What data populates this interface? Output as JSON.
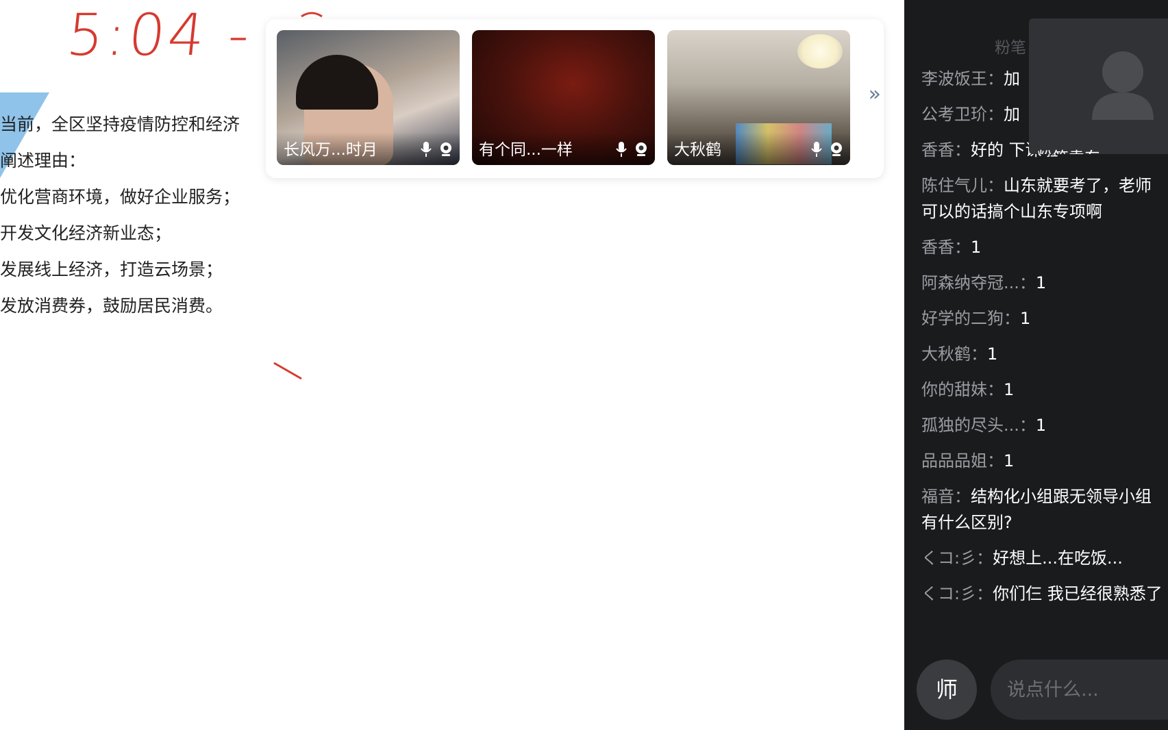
{
  "whiteboard": {
    "handwritten_time": "5:04 -",
    "lines": [
      "当前，全区坚持疫情防控和经济",
      "阐述理由：",
      "优化营商环境，做好企业服务；",
      "开发文化经济新业态；",
      "发展线上经济，打造云场景；",
      "发放消费券，鼓励居民消费。"
    ]
  },
  "video_strip": {
    "tiles": [
      {
        "name": "长风万...时月"
      },
      {
        "name": "有个同...一样"
      },
      {
        "name": "大秋鹤"
      }
    ],
    "more_icon": "double-chevron-right-icon",
    "more_label": "»"
  },
  "chat": {
    "header_faint": "粉笔",
    "host": {
      "name": "粉笔袁东",
      "icon": "user-avatar-icon"
    },
    "messages": [
      {
        "nick": "李波饭王：",
        "text": "加"
      },
      {
        "nick": "公考卫玠：",
        "text": "加"
      },
      {
        "nick": "香香：",
        "text": "好的 下课啦"
      },
      {
        "nick": "陈住气儿：",
        "text": "山东就要考了，老师可以的话搞个山东专项啊"
      },
      {
        "nick": "香香：",
        "text": "1"
      },
      {
        "nick": "阿森纳夺冠...：",
        "text": "1"
      },
      {
        "nick": "好学的二狗：",
        "text": "1"
      },
      {
        "nick": "大秋鹤：",
        "text": "1"
      },
      {
        "nick": "你的甜妹：",
        "text": "1"
      },
      {
        "nick": "孤独的尽头...：",
        "text": "1"
      },
      {
        "nick": "品品品姐：",
        "text": "1"
      },
      {
        "nick": "福音：",
        "text": "结构化小组跟无领导小组有什么区别?"
      },
      {
        "nick": "くコ:彡：",
        "text": "好想上...在吃饭..."
      },
      {
        "nick": "くコ:彡：",
        "text": "你们仨 我已经很熟悉了"
      }
    ],
    "teacher_button_label": "师",
    "input_placeholder": "说点什么..."
  },
  "colors": {
    "ink_red": "#d63a2f",
    "accent_blue": "#8fc3ea",
    "chat_bg": "#1a1b1d",
    "nick_gray": "#9a9da2"
  }
}
